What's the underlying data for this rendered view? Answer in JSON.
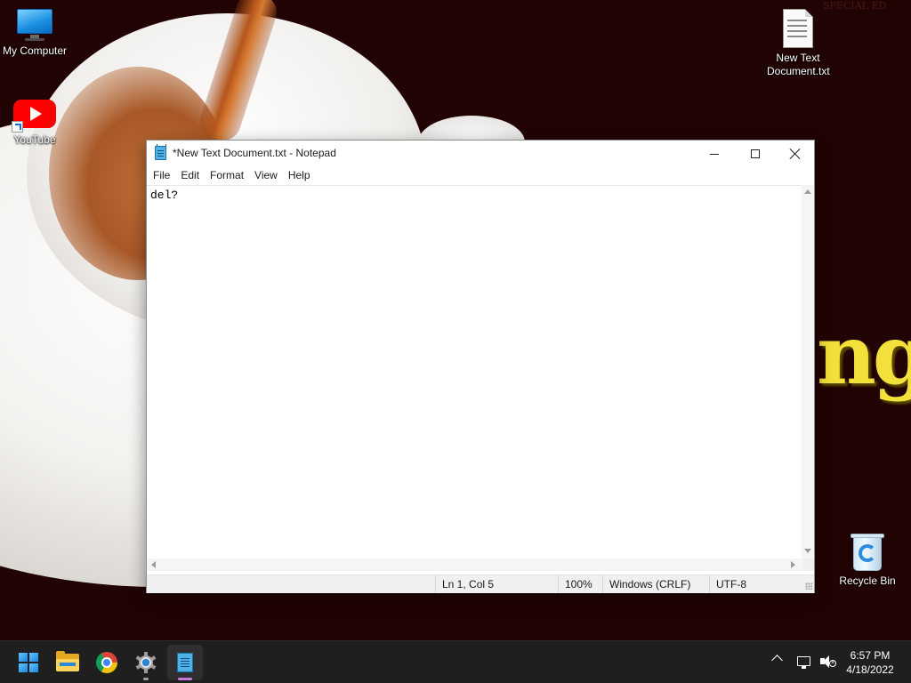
{
  "desktop": {
    "icons": [
      {
        "label": "My Computer",
        "icon": "monitor-icon"
      },
      {
        "label": "YouTube",
        "icon": "youtube-icon"
      },
      {
        "label": "New Text Document.txt",
        "icon": "text-file-icon"
      },
      {
        "label": "Recycle Bin",
        "icon": "recycle-bin-icon"
      }
    ],
    "wallpaper_text": "ng",
    "wallpaper_mark": "SPECIAL ED"
  },
  "notepad": {
    "title": "*New Text Document.txt - Notepad",
    "menu": [
      "File",
      "Edit",
      "Format",
      "View",
      "Help"
    ],
    "content": "del?",
    "status": {
      "position": "Ln 1, Col 5",
      "zoom": "100%",
      "line_endings": "Windows (CRLF)",
      "encoding": "UTF-8"
    }
  },
  "taskbar": {
    "apps": [
      {
        "name": "Start",
        "icon": "windows-logo-icon"
      },
      {
        "name": "File Explorer",
        "icon": "folder-icon"
      },
      {
        "name": "Google Chrome",
        "icon": "chrome-icon"
      },
      {
        "name": "Settings",
        "icon": "gear-icon"
      },
      {
        "name": "Notepad",
        "icon": "notepad-icon",
        "active": true
      }
    ],
    "clock": {
      "time": "6:57 PM",
      "date": "4/18/2022"
    }
  },
  "colors": {
    "wallpaper_bg": "#220303",
    "taskbar_bg": "#1f1f1f",
    "wallpaper_text": "#f3e03a",
    "active_indicator": "#c57bd8"
  }
}
